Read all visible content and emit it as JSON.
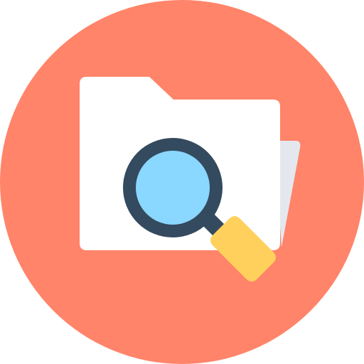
{
  "icon": {
    "name": "folder-search-icon",
    "colors": {
      "background_circle": "#FF8469",
      "folder_front": "#FFFFFF",
      "folder_back": "#E4E8EE",
      "lens_glass": "#8AD7FF",
      "lens_rim": "#344A5E",
      "handle": "#FFD15C"
    }
  }
}
